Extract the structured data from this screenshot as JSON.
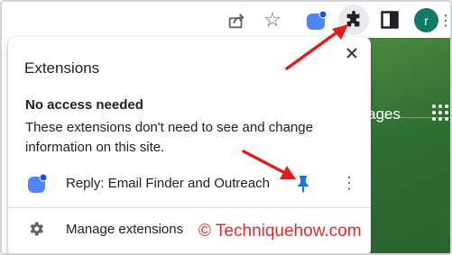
{
  "toolbar": {
    "icons": [
      "share-icon",
      "star-icon",
      "extension-app-icon",
      "puzzle-icon",
      "side-panel-icon",
      "avatar",
      "more-menu-icon"
    ],
    "avatar_initial": "r",
    "star_glyph": "☆",
    "kebab_glyph": "⋮"
  },
  "page": {
    "partial_text": "ages"
  },
  "popup": {
    "title": "Extensions",
    "close_glyph": "✕",
    "section_heading": "No access needed",
    "section_description": "These extensions don't need to see and change information on this site.",
    "extension": {
      "name": "Reply: Email Finder and Outreach",
      "more_glyph": "⋮"
    },
    "manage_label": "Manage extensions"
  },
  "watermark": "© Techniquehow.com",
  "colors": {
    "accent_blue": "#1a73e8",
    "arrow_red": "#e21b1b",
    "avatar_green": "#117a67",
    "page_green": "#2f6e33"
  }
}
